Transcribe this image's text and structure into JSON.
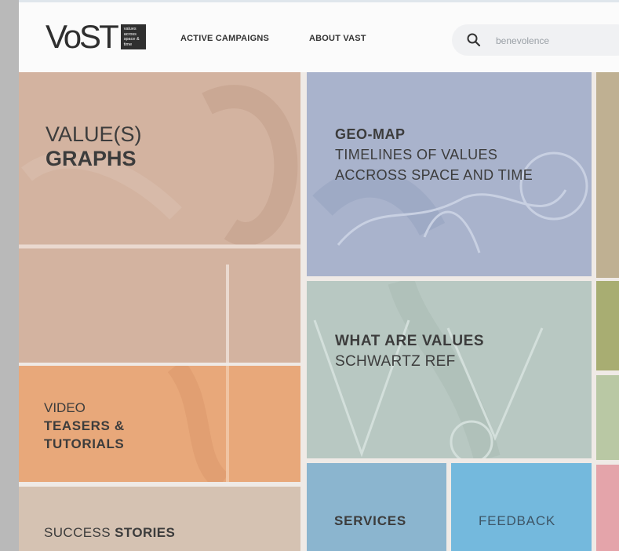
{
  "header": {
    "logo_text": "VoST",
    "logo_tagline": "values across space & time",
    "nav": [
      {
        "label": "ACTIVE CAMPAIGNS"
      },
      {
        "label": "ABOUT VAST"
      }
    ],
    "search": {
      "placeholder": "benevolence",
      "value": ""
    }
  },
  "tiles": {
    "graphs": {
      "light": "VALUE(S)",
      "bold": "GRAPHS"
    },
    "geo_map": {
      "bold": "GEO-MAP",
      "light": "TIMELINES OF VALUES ACCROSS SPACE AND TIME"
    },
    "what_are_values": {
      "bold": "WHAT ARE VALUES",
      "light": "SCHWARTZ REF"
    },
    "video": {
      "light": "VIDEO",
      "bold": "TEASERS & TUTORIALS"
    },
    "success": {
      "light": "SUCCESS",
      "bold": "STORIES"
    },
    "services": {
      "bold": "SERVICES"
    },
    "feedback": {
      "light": "FEEDBACK"
    }
  },
  "colors": {
    "graphs": "#d3b3a0",
    "video": "#e8a87a",
    "success": "#d5c2b2",
    "geo_map": "#a9b3cc",
    "what_are_values": "#b8c8c2",
    "services": "#8bb5cf",
    "feedback": "#74b9dd"
  }
}
